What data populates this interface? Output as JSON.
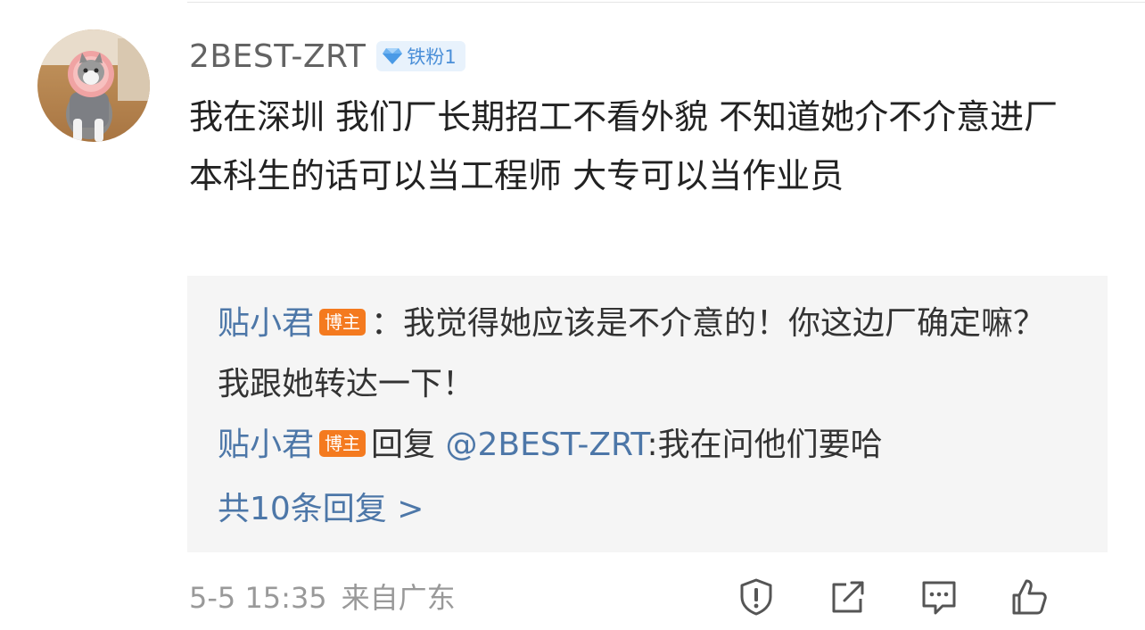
{
  "comment": {
    "username": "2BEST-ZRT",
    "fan_badge": "铁粉1",
    "text": "我在深圳 我们厂长期招工不看外貌 不知道她介不介意进厂 本科生的话可以当工程师 大专可以当作业员"
  },
  "replies": [
    {
      "author": "贴小君",
      "badge": "博主",
      "separator": "：",
      "text": "我觉得她应该是不介意的！你这边厂确定嘛？我跟她转达一下！"
    },
    {
      "author": "贴小君",
      "badge": "博主",
      "reply_word": "回复",
      "mention": "@2BEST-ZRT",
      "text": ":我在问他们要哈"
    }
  ],
  "more_replies_label": "共10条回复 >",
  "footer": {
    "time": "5-5 15:35",
    "location": "来自广东"
  },
  "icons": {
    "report": "report-icon",
    "forward": "forward-icon",
    "comment": "comment-icon",
    "like": "like-icon"
  },
  "colors": {
    "link_blue": "#4d77a8",
    "host_badge": "#f47a1f",
    "fan_badge_bg": "#e8f2fc",
    "fan_badge_text": "#4a8fd8",
    "reply_box_bg": "#f5f5f5"
  }
}
